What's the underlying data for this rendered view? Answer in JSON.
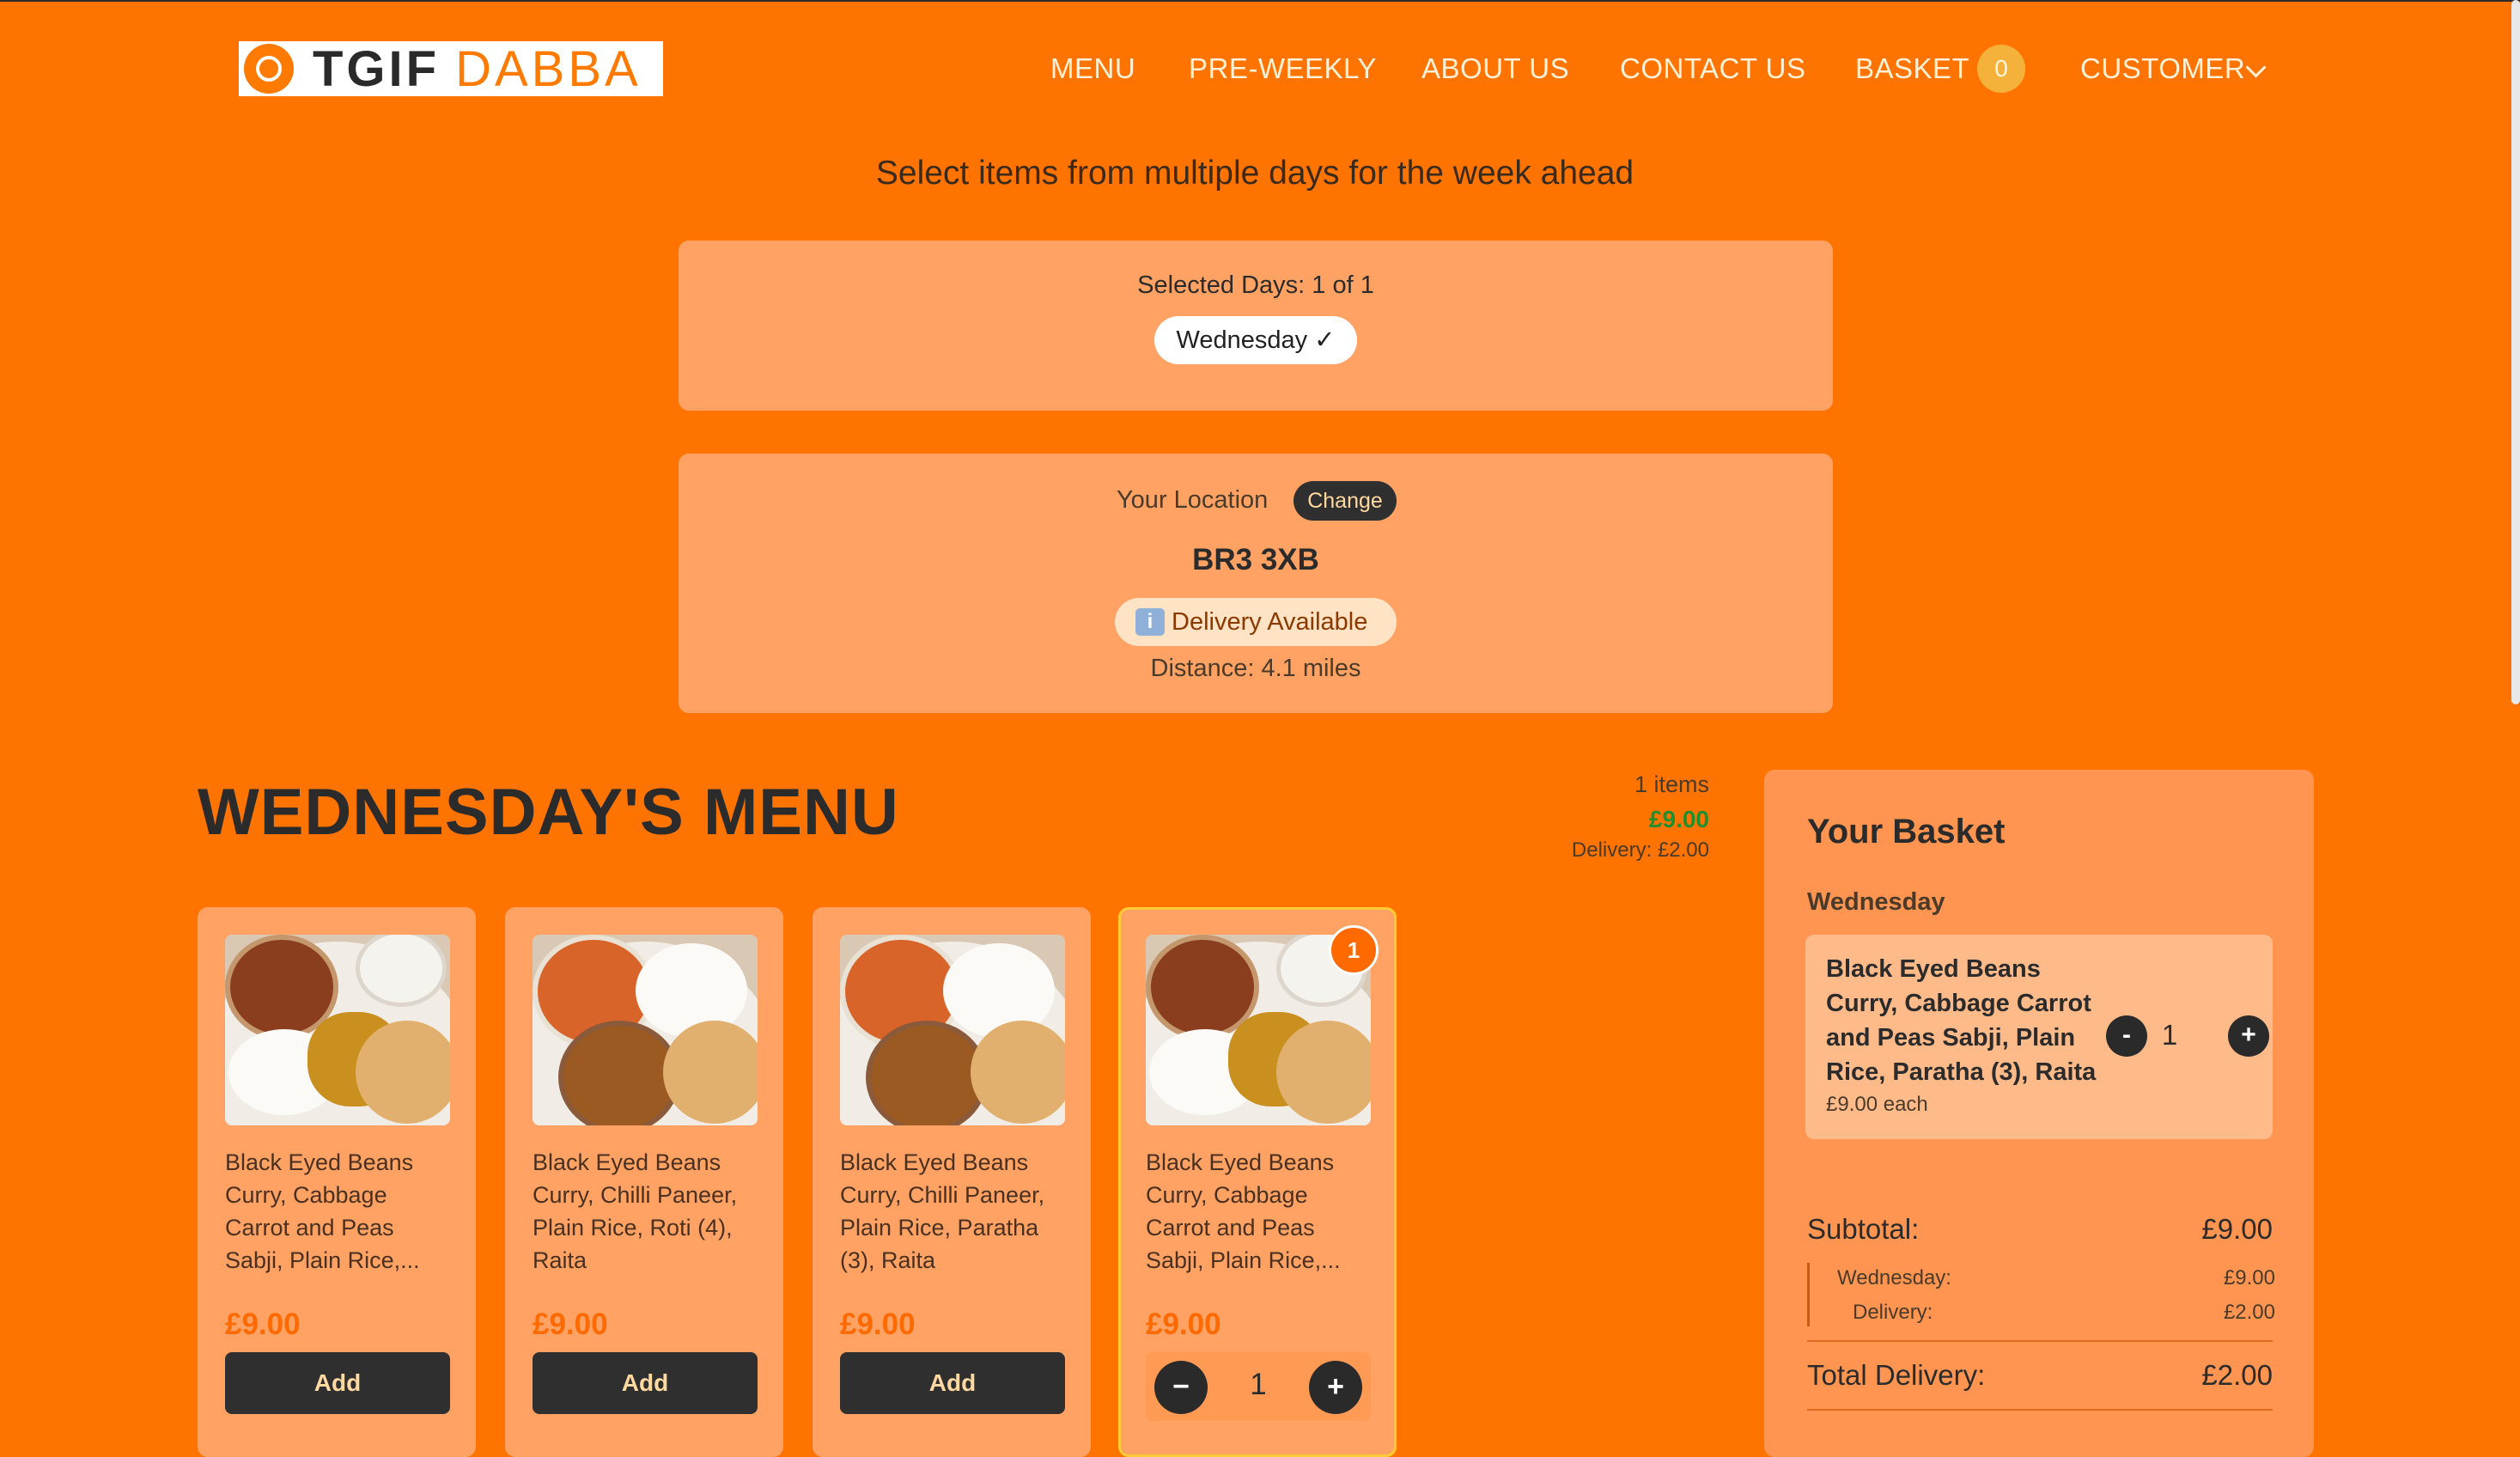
{
  "header": {
    "logo_text_bold": "TGIF",
    "logo_text_light": "DABBA",
    "nav": {
      "menu": "MENU",
      "pre_weekly": "PRE-WEEKLY",
      "about": "ABOUT US",
      "contact": "CONTACT US",
      "basket": "BASKET",
      "basket_count": "0",
      "customer": "CUSTOMER"
    }
  },
  "subtitle": "Select items from multiple days for the week ahead",
  "days": {
    "selected_label": "Selected Days: 1 of 1",
    "chip": "Wednesday ✓"
  },
  "location": {
    "label": "Your Location",
    "change_label": "Change",
    "postcode": "BR3 3XB",
    "delivery_status": "Delivery Available",
    "info_icon": "i",
    "distance": "Distance: 4.1 miles"
  },
  "menu": {
    "title": "WEDNESDAY'S MENU",
    "summary": {
      "items": "1 items",
      "price": "£9.00",
      "delivery": "Delivery: £2.00"
    },
    "cards": [
      {
        "name": "Black Eyed Beans Curry, Cabbage Carrot and Peas Sabji, Plain Rice,...",
        "price": "£9.00",
        "action": "Add"
      },
      {
        "name": "Black Eyed Beans Curry, Chilli Paneer, Plain Rice, Roti (4), Raita",
        "price": "£9.00",
        "action": "Add"
      },
      {
        "name": "Black Eyed Beans Curry, Chilli Paneer, Plain Rice, Paratha (3), Raita",
        "price": "£9.00",
        "action": "Add"
      },
      {
        "name": "Black Eyed Beans Curry, Cabbage Carrot and Peas Sabji, Plain Rice,...",
        "price": "£9.00",
        "badge": "1",
        "qty": "1",
        "minus": "−",
        "plus": "+"
      }
    ]
  },
  "basket": {
    "title": "Your Basket",
    "day": "Wednesday",
    "item": {
      "name": "Black Eyed Beans Curry, Cabbage Carrot and Peas Sabji, Plain Rice, Paratha (3), Raita",
      "each": "£9.00 each",
      "qty": "1",
      "minus": "-",
      "plus": "+"
    },
    "subtotal_label": "Subtotal:",
    "subtotal_value": "£9.00",
    "breakdown": {
      "wed_label": "Wednesday:",
      "wed_value": "£9.00",
      "delivery_label": "Delivery:",
      "delivery_value": "£2.00"
    },
    "total_delivery_label": "Total Delivery:",
    "total_delivery_value": "£2.00"
  },
  "colors": {
    "background": "#ff7300",
    "panel": "#ffa263",
    "accent_price": "#ff6a00",
    "dark_button": "#2f2f2f",
    "green_total": "#1f8f2f"
  }
}
